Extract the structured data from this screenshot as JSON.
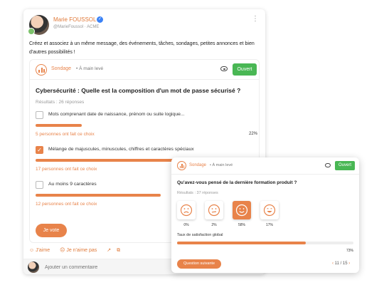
{
  "post": {
    "author": "Marie FOUSSOL",
    "handle": "@MarieFoussol · ACME",
    "text": "Créez et associez à un même message, des événements, tâches, sondages, petites annonces et bien d'autres possibilités !",
    "poll": {
      "label": "Sondage",
      "mode": "À main levé",
      "open_label": "Ouvert",
      "question": "Cybersécurité : Quelle est la composition d'un mot de passe sécurisé ?",
      "results": "Résultats : 26 réponses",
      "options": [
        {
          "label": "Mots comprenant date de naissance, prénom ou suite logique...",
          "count": "5 personnes ont fait ce choix",
          "pct": "22%",
          "fill": 0.22,
          "checked": false
        },
        {
          "label": "Mélange de majuscules, minuscules, chiffres et caractères spéciaux",
          "count": "17 personnes ont fait ce choix",
          "pct": "",
          "fill": 0.95,
          "checked": true
        },
        {
          "label": "Au moins 9 caractères",
          "count": "12 personnes ont fait ce choix",
          "pct": "",
          "fill": 0.6,
          "checked": false
        }
      ],
      "vote_label": "Je vote"
    },
    "reactions": {
      "like": "J'aime",
      "dislike": "Je n'aime pas"
    },
    "comment_placeholder": "Ajouter un commentaire"
  },
  "card2": {
    "label": "Sondage",
    "mode": "À main levé",
    "open_label": "Ouvert",
    "question": "Qu'avez-vous pensé de la dernière formation produit ?",
    "results": "Résultats : 37 réponses",
    "faces": [
      {
        "icon": "sad-face-icon",
        "pct": "0%",
        "selected": false
      },
      {
        "icon": "neutral-face-icon",
        "pct": "2%",
        "selected": false
      },
      {
        "icon": "smile-face-icon",
        "pct": "58%",
        "selected": true
      },
      {
        "icon": "happy-face-icon",
        "pct": "17%",
        "selected": false
      }
    ],
    "satisfaction_label": "Taux de satisfaction global",
    "satisfaction_pct": "73%",
    "satisfaction_value": 0.73,
    "next_label": "Question suivante",
    "pager": "11 / 15"
  },
  "colors": {
    "accent": "#e8834a",
    "open": "#49b754"
  }
}
